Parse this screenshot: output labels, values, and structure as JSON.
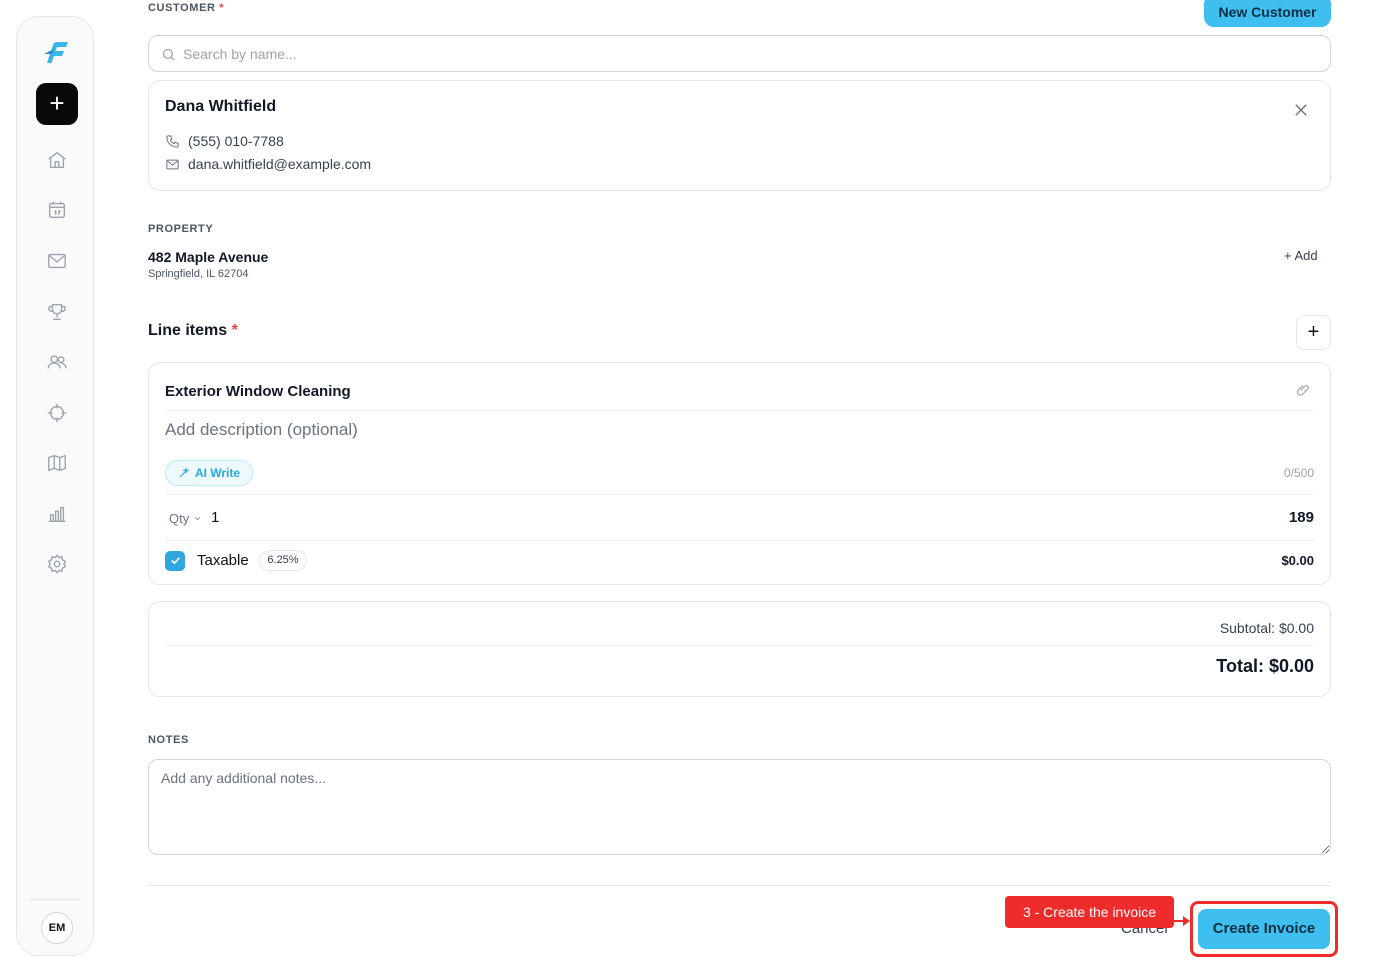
{
  "sidebar": {
    "add_label": "+",
    "nav_icons": [
      "home-icon",
      "calendar-icon",
      "mail-icon",
      "trophy-icon",
      "users-icon",
      "target-icon",
      "map-icon",
      "chart-icon",
      "settings-icon"
    ],
    "avatar_initials": "EM"
  },
  "customer": {
    "section_label": "CUSTOMER",
    "required_mark": "*",
    "new_button": "New Customer",
    "search_placeholder": "Search by name...",
    "selected": {
      "name": "Dana Whitfield",
      "phone": "(555) 010-7788",
      "email": "dana.whitfield@example.com"
    }
  },
  "property": {
    "section_label": "PROPERTY",
    "address_line1": "482 Maple Avenue",
    "address_line2": "Springfield, IL 62704",
    "add_label": "+ Add"
  },
  "line_items": {
    "title": "Line items",
    "required_mark": "*",
    "add_label": "+",
    "items": [
      {
        "name": "Exterior Window Cleaning",
        "description_placeholder": "Add description (optional)",
        "ai_write_label": "AI Write",
        "char_count": "0/500",
        "qty_label": "Qty",
        "qty": "1",
        "price": "189",
        "taxable_label": "Taxable",
        "tax_rate": "6.25%",
        "tax_amount": "$0.00",
        "taxable_checked": true
      }
    ]
  },
  "totals": {
    "subtotal": "Subtotal: $0.00",
    "total": "Total: $0.00"
  },
  "notes": {
    "section_label": "NOTES",
    "placeholder": "Add any additional notes..."
  },
  "footer": {
    "cancel_label": "Cancel",
    "create_label": "Create Invoice",
    "callout_text": "3 - Create the invoice"
  },
  "colors": {
    "accent": "#3fbef0",
    "highlight": "#ef2b2b",
    "required": "#ef4444"
  }
}
